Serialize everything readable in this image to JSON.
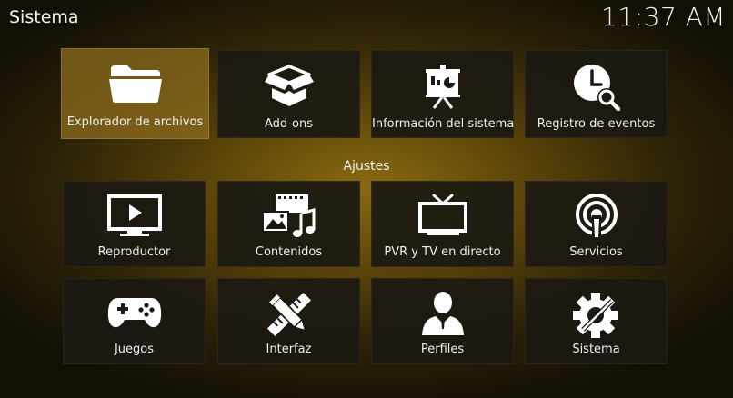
{
  "header": {
    "title": "Sistema",
    "clock": "11:37 AM"
  },
  "top_tiles": [
    {
      "label": "Explorador de archivos",
      "icon": "folder-icon"
    },
    {
      "label": "Add-ons",
      "icon": "box-icon"
    },
    {
      "label": "Información del sistema",
      "icon": "presentation-icon"
    },
    {
      "label": "Registro de eventos",
      "icon": "clock-search-icon"
    }
  ],
  "section_title": "Ajustes",
  "settings_tiles": [
    {
      "label": "Reproductor",
      "icon": "play-screen-icon"
    },
    {
      "label": "Contenidos",
      "icon": "media-library-icon"
    },
    {
      "label": "PVR y TV en directo",
      "icon": "tv-icon"
    },
    {
      "label": "Servicios",
      "icon": "broadcast-icon"
    },
    {
      "label": "Juegos",
      "icon": "gamepad-icon"
    },
    {
      "label": "Interfaz",
      "icon": "pencil-ruler-icon"
    },
    {
      "label": "Perfiles",
      "icon": "user-profile-icon"
    },
    {
      "label": "Sistema",
      "icon": "gear-tools-icon"
    }
  ],
  "colors": {
    "accent": "#8c6c1e",
    "tile_bg": "#1c1912",
    "text": "#f2f2f2"
  }
}
